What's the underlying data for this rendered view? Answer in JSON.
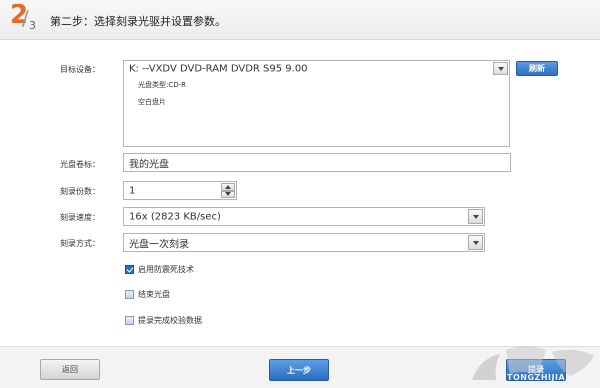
{
  "header": {
    "step_current": "2",
    "step_total": "3",
    "title": "第二步：选择刻录光驱并设置参数。"
  },
  "form": {
    "target_device": {
      "label": "目标设备：",
      "value": "K:  --VXDV    DVD-RAM DVDR S95 9.00",
      "refresh_label": "刷新",
      "disc_type": "光盘类型:CD-R",
      "disc_status": "空白盘片"
    },
    "volume_label": {
      "label": "光盘卷标：",
      "value": "我的光盘"
    },
    "copies": {
      "label": "刻录份数：",
      "value": "1"
    },
    "speed": {
      "label": "刻录速度：",
      "value": "16x (2823 KB/sec)"
    },
    "mode": {
      "label": "刻录方式：",
      "value": "光盘一次刻录"
    },
    "options": [
      {
        "label": "启用防震死技术",
        "checked": true
      },
      {
        "label": "结束光盘",
        "checked": false
      },
      {
        "label": "提录完成校验数据",
        "checked": false
      }
    ]
  },
  "footer": {
    "back_label": "返回",
    "prev_label": "上一步",
    "next_label": "提录",
    "watermark": "TONGZHIJIA"
  },
  "colors": {
    "accent_orange": "#e8682a",
    "button_blue": "#2f6fbf"
  }
}
